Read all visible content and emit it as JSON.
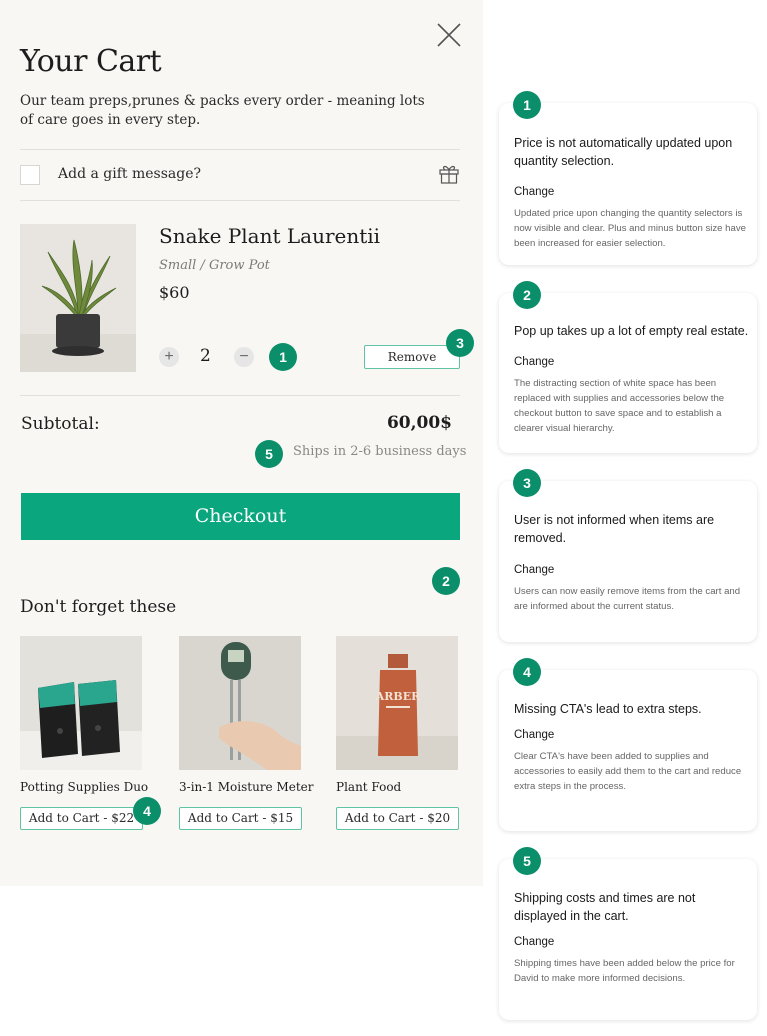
{
  "cart": {
    "title": "Your Cart",
    "subtitle": "Our team preps,prunes & packs every order - meaning lots of care goes in every step.",
    "gift_label": "Add a gift message?",
    "item": {
      "name": "Snake Plant Laurentii",
      "variant": "Small / Grow Pot",
      "price": "$60",
      "quantity": "2",
      "remove_label": "Remove"
    },
    "subtotal_label": "Subtotal:",
    "subtotal_value": "60,00$",
    "shipping_note": "Ships in 2-6 business days",
    "checkout_label": "Checkout",
    "upsell_title": "Don't forget these",
    "upsell_items": [
      {
        "name": "Potting Supplies Duo",
        "button": "Add to Cart - $22"
      },
      {
        "name": "3-in-1 Moisture Meter",
        "button": "Add to Cart - $15"
      },
      {
        "name": "Plant Food",
        "button": "Add to Cart - $20",
        "brand_text": "ARBER"
      }
    ]
  },
  "markers": {
    "m1": "1",
    "m2": "2",
    "m3": "3",
    "m4": "4",
    "m5": "5"
  },
  "notes": [
    {
      "number": "1",
      "title": "Price is not automatically updated upon quantity selection.",
      "change_label": "Change",
      "description": "Updated price upon changing the quantity selectors is now visible and clear. Plus and minus button size have been increased for easier selection."
    },
    {
      "number": "2",
      "title": "Pop up takes up a lot of empty real estate.",
      "change_label": "Change",
      "description": "The distracting section of white space has been replaced with supplies and accessories below the checkout button to save space and to establish a clearer visual hierarchy."
    },
    {
      "number": "3",
      "title": "User is not informed when items are removed.",
      "change_label": "Change",
      "description": "Users can now easily remove items from the cart and are informed about the current status."
    },
    {
      "number": "4",
      "title": "Missing CTA's lead to extra steps.",
      "change_label": "Change",
      "description": "Clear CTA's have been added to supplies and accessories to easily add them to the cart and reduce extra steps in the process."
    },
    {
      "number": "5",
      "title": "Shipping costs and times are not displayed in the cart.",
      "change_label": "Change",
      "description": "Shipping times have been added below the price for David to make more informed decisions."
    }
  ],
  "colors": {
    "accent": "#0aa77e",
    "marker": "#0b8f6b",
    "panel_bg": "#f8f7f4",
    "outline": "#5fc4a4"
  },
  "icons": {
    "close": "close-icon",
    "gift": "gift-icon",
    "plus": "plus-icon",
    "minus": "minus-icon"
  }
}
